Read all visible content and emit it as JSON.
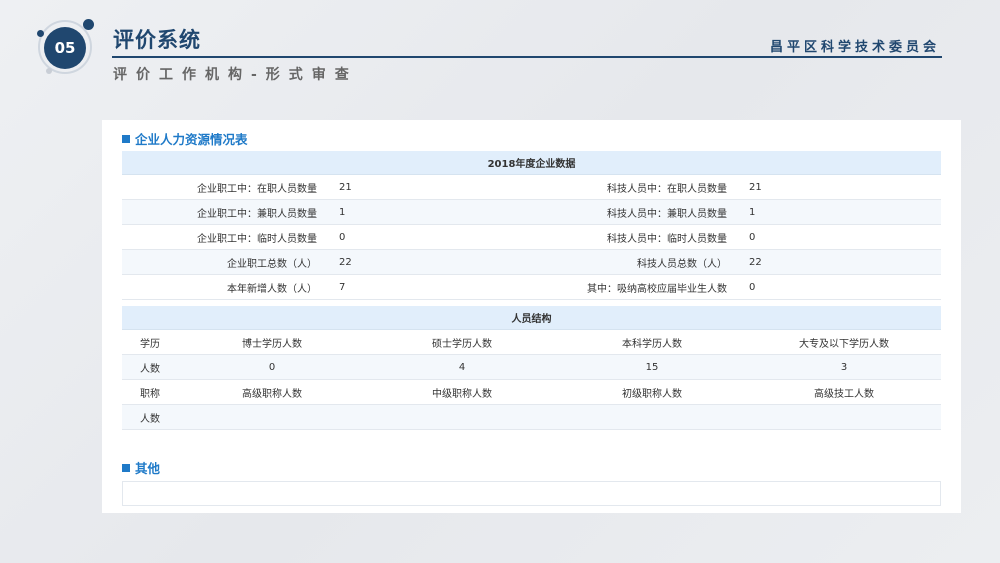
{
  "header": {
    "badge": "05",
    "title": "评价系统",
    "org": "昌平区科学技术委员会",
    "subtitle": "评价工作机构-形式审查"
  },
  "hr_section": {
    "title": "企业人力资源情况表",
    "year_header": "2018年度企业数据",
    "rows": [
      {
        "l_label": "企业职工中：在职人员数量",
        "l_value": "21",
        "r_label": "科技人员中：在职人员数量",
        "r_value": "21"
      },
      {
        "l_label": "企业职工中：兼职人员数量",
        "l_value": "1",
        "r_label": "科技人员中：兼职人员数量",
        "r_value": "1"
      },
      {
        "l_label": "企业职工中：临时人员数量",
        "l_value": "0",
        "r_label": "科技人员中：临时人员数量",
        "r_value": "0"
      },
      {
        "l_label": "企业职工总数（人）",
        "l_value": "22",
        "r_label": "科技人员总数（人）",
        "r_value": "22"
      },
      {
        "l_label": "本年新增人数（人）",
        "l_value": "7",
        "r_label": "其中：吸纳高校应届毕业生人数",
        "r_value": "0"
      }
    ]
  },
  "structure": {
    "header": "人员结构",
    "edu_label": "学历",
    "edu_cols": [
      "博士学历人数",
      "硕士学历人数",
      "本科学历人数",
      "大专及以下学历人数"
    ],
    "count_label": "人数",
    "edu_counts": [
      "0",
      "4",
      "15",
      "3"
    ],
    "title_label": "职称",
    "title_cols": [
      "高级职称人数",
      "中级职称人数",
      "初级职称人数",
      "高级技工人数"
    ],
    "title_count_label": "人数",
    "title_counts": [
      "",
      "",
      "",
      ""
    ]
  },
  "other_section": {
    "title": "其他"
  }
}
